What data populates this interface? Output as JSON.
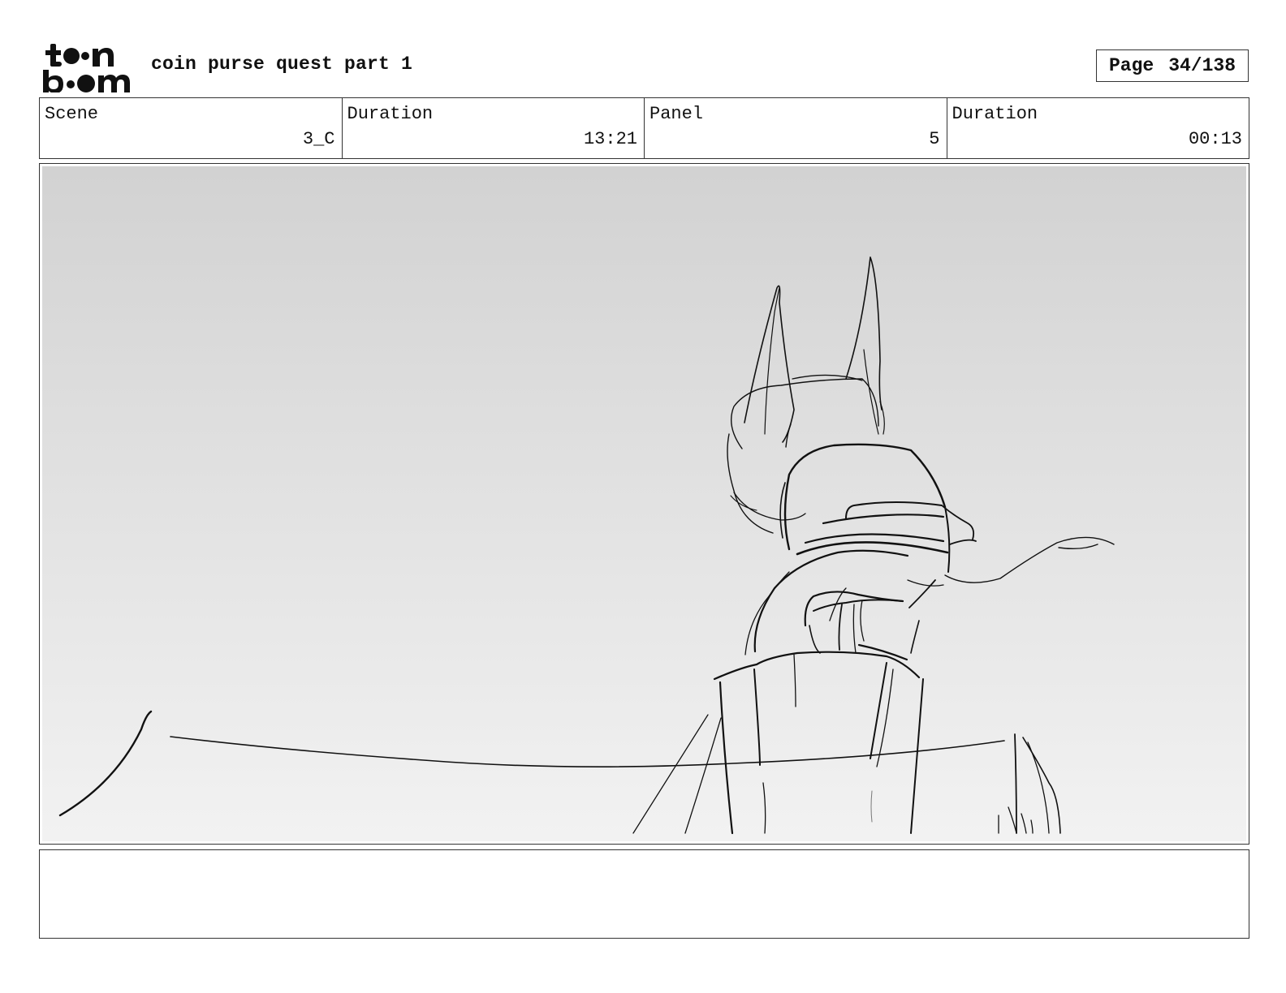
{
  "header": {
    "logo": {
      "icon": "toonboom-logo",
      "text": "toon boom"
    },
    "document_title": "coin purse quest part 1",
    "page": {
      "label": "Page",
      "value": "34/138"
    }
  },
  "info_bar": {
    "cells": [
      {
        "label": "Scene",
        "value": "3_C"
      },
      {
        "label": "Duration",
        "value": "13:21"
      },
      {
        "label": "Panel",
        "value": "5"
      },
      {
        "label": "Duration",
        "value": "00:13"
      }
    ]
  },
  "panel": {
    "image": "sketch-cat-on-post-icon",
    "background_top": "#d2d2d2",
    "background_bottom": "#f2f2f2",
    "line_color": "#111111"
  },
  "notes": {
    "text": ""
  }
}
